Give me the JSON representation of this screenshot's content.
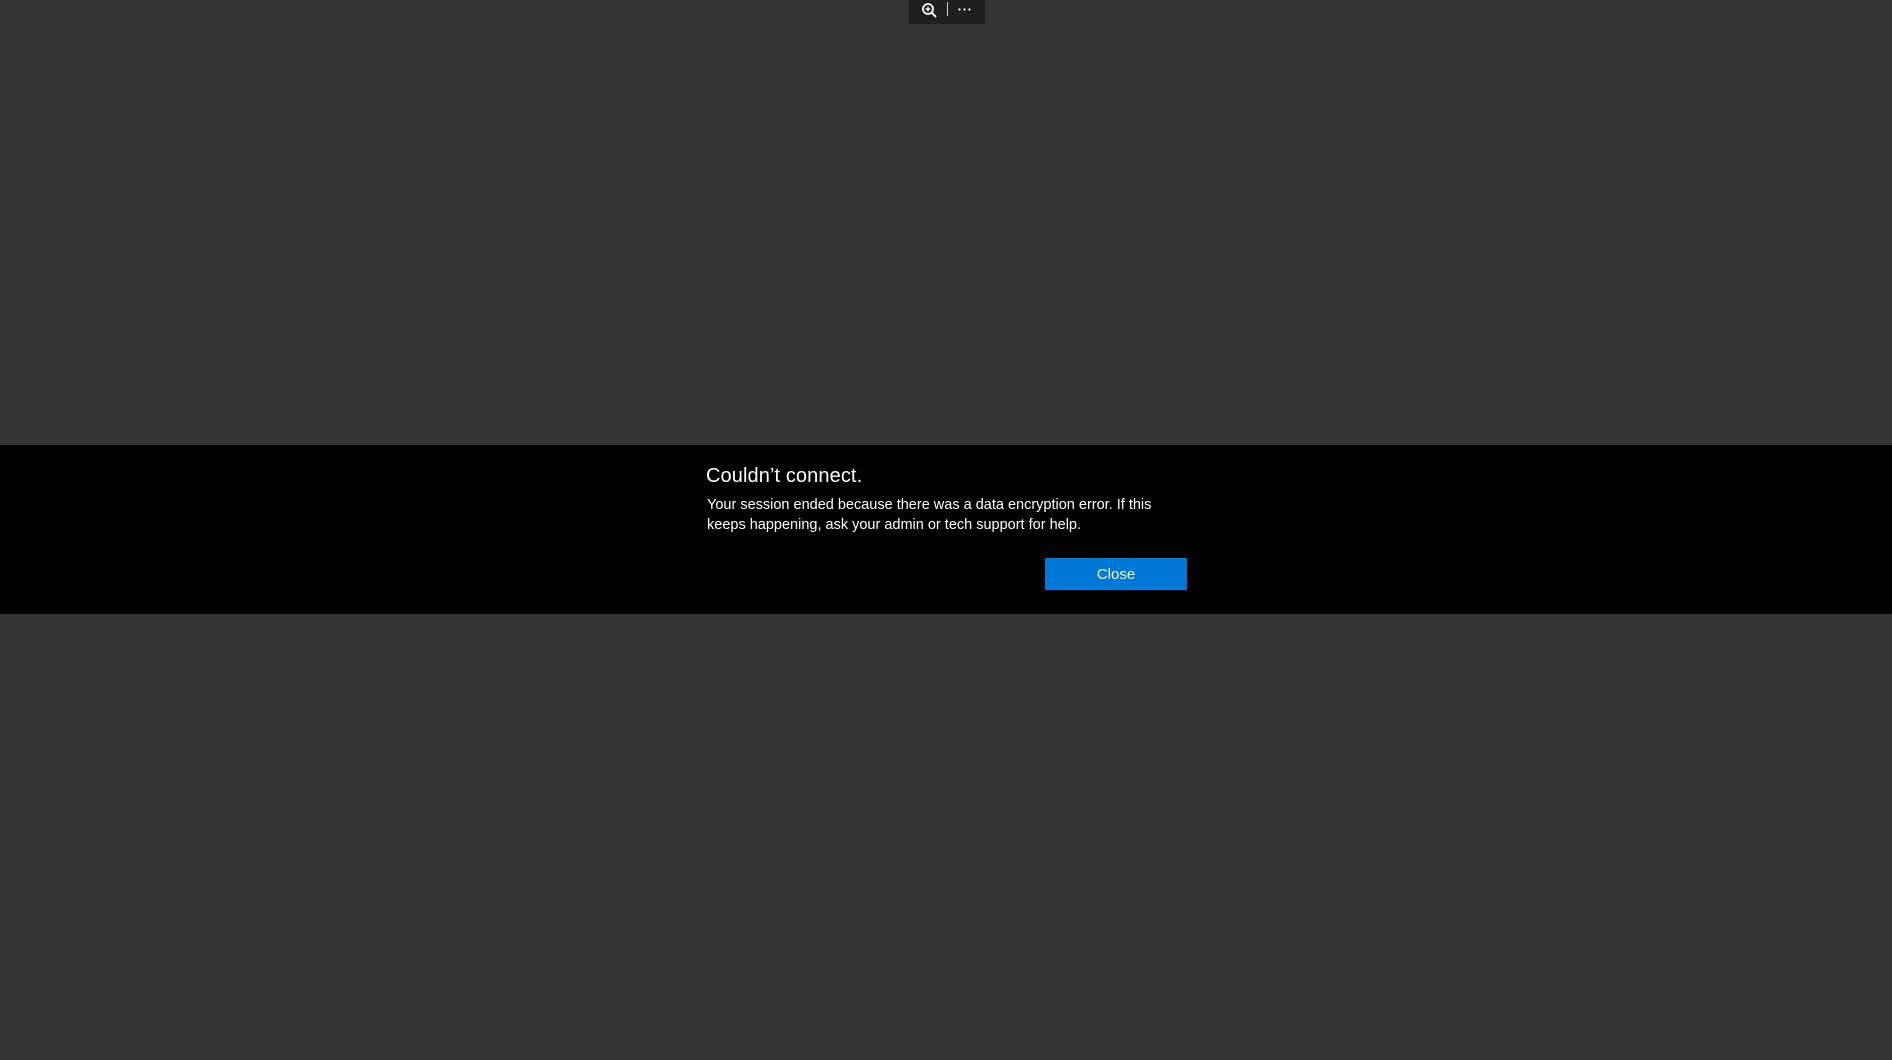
{
  "toolbar": {
    "zoom_icon": "zoom-in-icon",
    "more_icon": "more-icon",
    "more_glyph": "···"
  },
  "dialog": {
    "title": "Couldn’t connect.",
    "message": "Your session ended because there was a data encryption error. If this keeps happening, ask your admin or tech support for help.",
    "close_label": "Close"
  },
  "colors": {
    "background": "#333333",
    "band": "#000000",
    "toolbar": "#1f1f1f",
    "accent": "#0078d7",
    "text": "#ffffff"
  }
}
